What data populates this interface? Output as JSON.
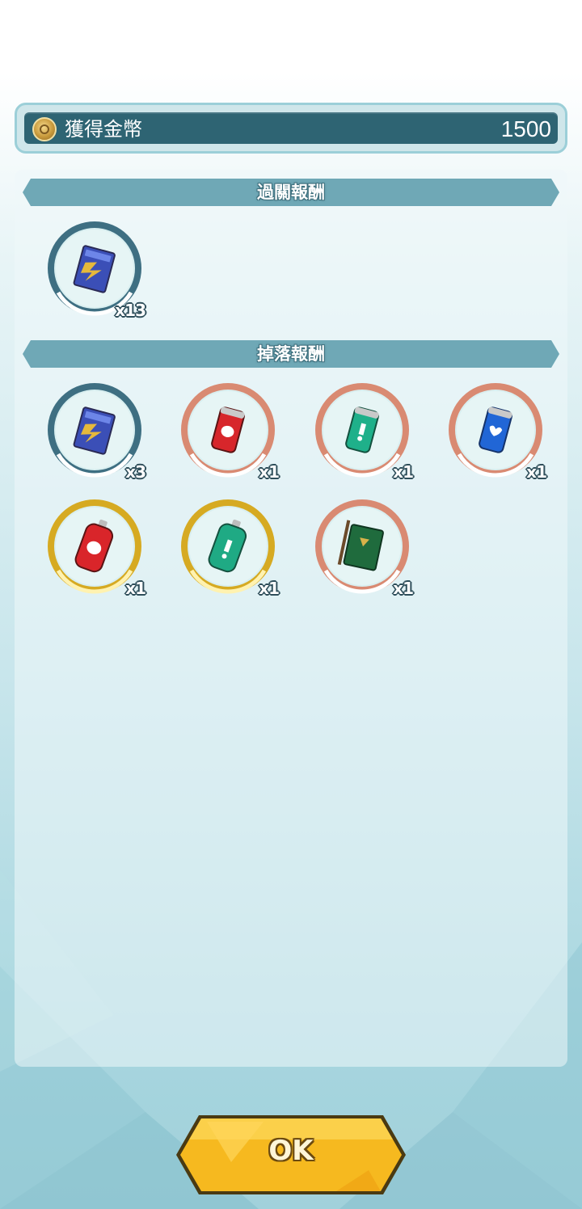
{
  "coin_bar": {
    "label": "獲得金幣",
    "value": "1500",
    "icon": "coin-icon"
  },
  "sections": {
    "clear_rewards": {
      "title": "過關報酬",
      "items": [
        {
          "icon": "blue-card-pack-icon",
          "qty": "x13",
          "rarity": "blue"
        }
      ]
    },
    "drop_rewards": {
      "title": "掉落報酬",
      "items": [
        {
          "icon": "blue-card-pack-icon",
          "qty": "x3",
          "rarity": "blue"
        },
        {
          "icon": "red-fist-can-icon",
          "qty": "x1",
          "rarity": "copper"
        },
        {
          "icon": "green-exclamation-can-icon",
          "qty": "x1",
          "rarity": "copper"
        },
        {
          "icon": "blue-heart-can-icon",
          "qty": "x1",
          "rarity": "copper"
        },
        {
          "icon": "red-fist-bottle-icon",
          "qty": "x1",
          "rarity": "gold"
        },
        {
          "icon": "green-exclamation-bottle-icon",
          "qty": "x1",
          "rarity": "gold"
        },
        {
          "icon": "green-notebook-icon",
          "qty": "x1",
          "rarity": "copper"
        }
      ]
    }
  },
  "ok_button": {
    "label": "OK"
  },
  "colors": {
    "header_bar": "#6fa8b6",
    "coin_bar": "#2e6473",
    "ring_blue": "#3e6f82",
    "ring_copper": "#d98a72",
    "ring_gold": "#d6aa22",
    "ok_button": "#f5b21c"
  }
}
